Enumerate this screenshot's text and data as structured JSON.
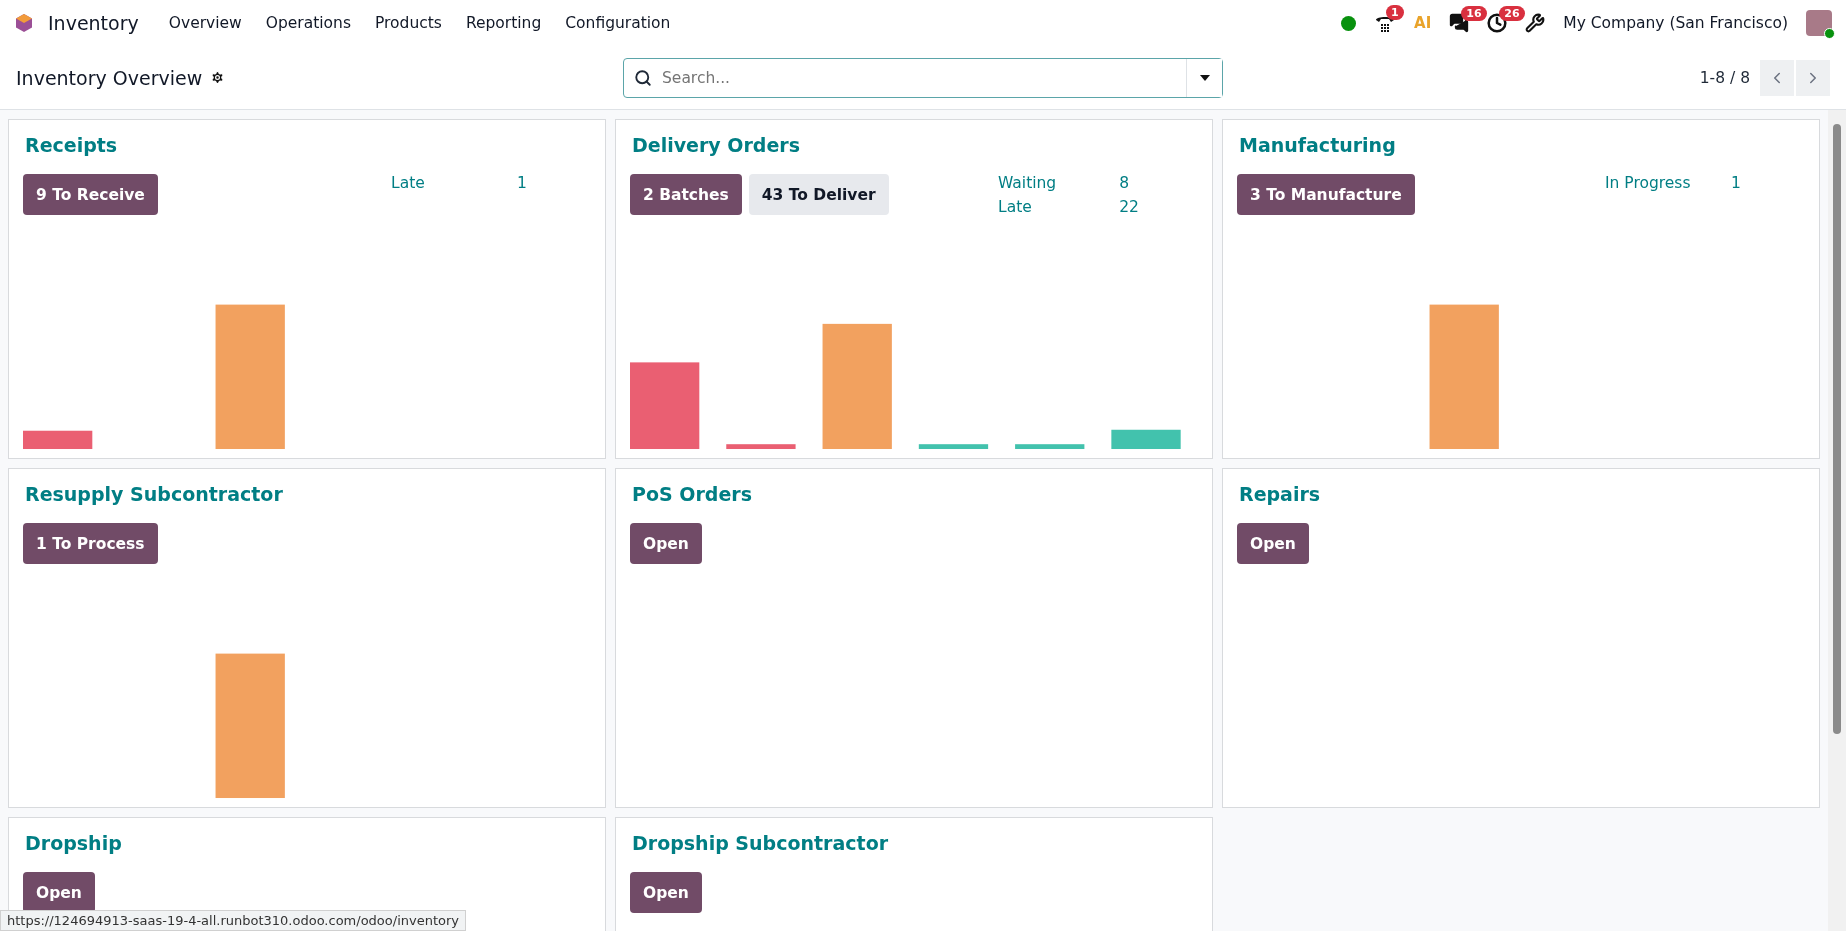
{
  "navbar": {
    "app_name": "Inventory",
    "menu": [
      "Overview",
      "Operations",
      "Products",
      "Reporting",
      "Configuration"
    ],
    "phone_badge": "1",
    "ai_label": "AI",
    "messages_badge": "16",
    "activities_badge": "26",
    "company": "My Company (San Francisco)"
  },
  "control_panel": {
    "title": "Inventory Overview",
    "search": {
      "placeholder": "Search..."
    },
    "pager": "1-8 / 8"
  },
  "cards": [
    {
      "title": "Receipts",
      "buttons": [
        {
          "label": "9 To Receive",
          "primary": true
        }
      ],
      "stats": [
        {
          "label": "Late",
          "value": "1"
        }
      ]
    },
    {
      "title": "Delivery Orders",
      "buttons": [
        {
          "label": "2 Batches",
          "primary": true
        },
        {
          "label": "43 To Deliver",
          "primary": false
        }
      ],
      "stats": [
        {
          "label": "Waiting",
          "value": "8"
        },
        {
          "label": "Late",
          "value": "22"
        }
      ]
    },
    {
      "title": "Manufacturing",
      "buttons": [
        {
          "label": "3 To Manufacture",
          "primary": true
        }
      ],
      "stats": [
        {
          "label": "In Progress",
          "value": "1"
        }
      ]
    },
    {
      "title": "Resupply Subcontractor",
      "buttons": [
        {
          "label": "1 To Process",
          "primary": true
        }
      ]
    },
    {
      "title": "PoS Orders",
      "buttons": [
        {
          "label": "Open",
          "primary": true
        }
      ]
    },
    {
      "title": "Repairs",
      "buttons": [
        {
          "label": "Open",
          "primary": true
        }
      ]
    },
    {
      "title": "Dropship",
      "buttons": [
        {
          "label": "Open",
          "primary": true
        }
      ]
    },
    {
      "title": "Dropship Subcontractor",
      "buttons": [
        {
          "label": "Open",
          "primary": true
        }
      ]
    }
  ],
  "status_url": "https://124694913-saas-19-4-all.runbot310.odoo.com/odoo/inventory"
}
